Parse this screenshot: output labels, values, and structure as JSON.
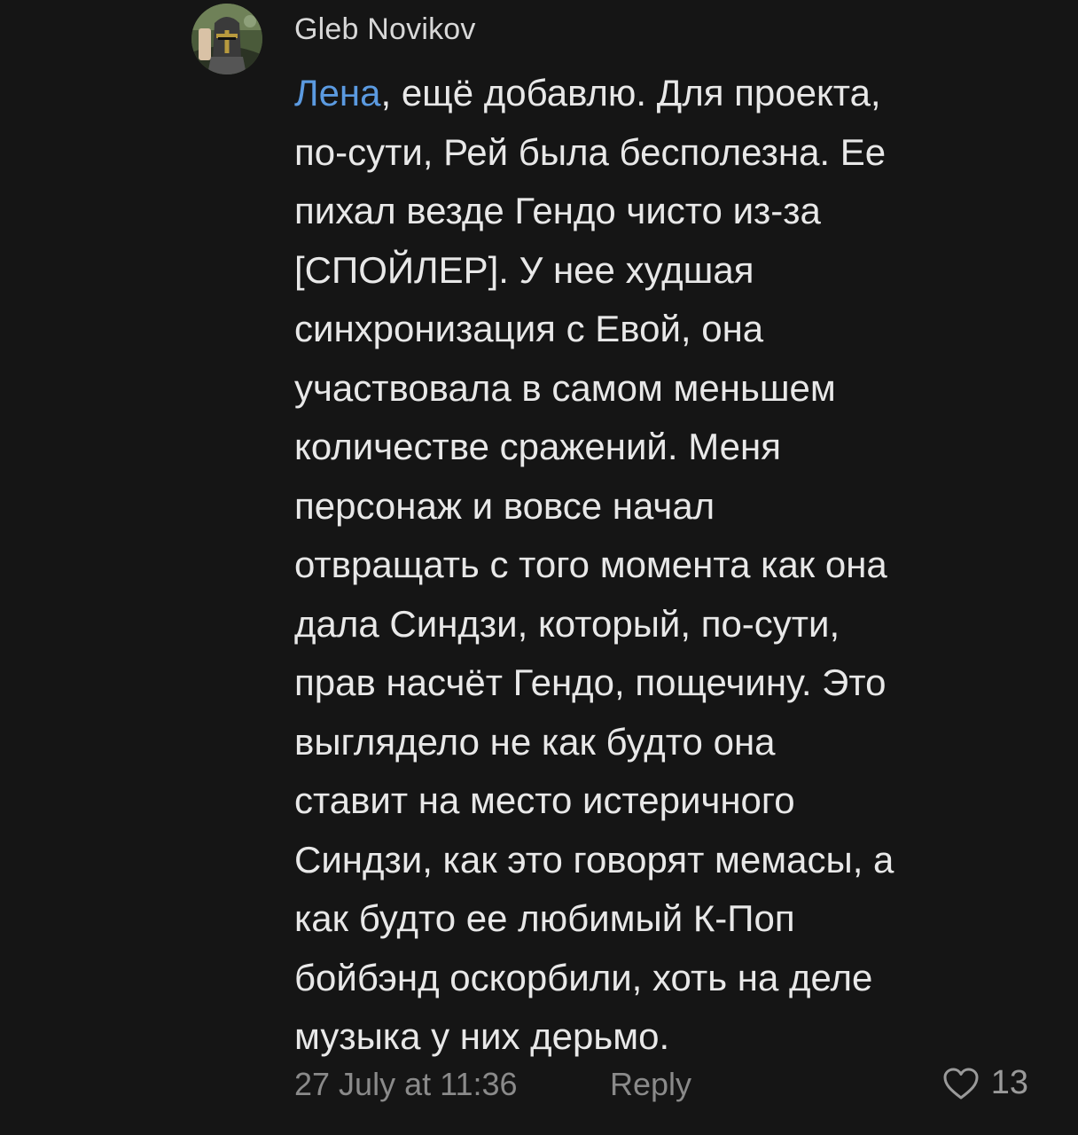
{
  "comment": {
    "author": "Gleb Novikov",
    "mention": "Лена",
    "first_line_rest": ", ещё добавлю. Для проекта,",
    "lines": [
      "по-сути, Рей была бесполезна. Ее",
      "пихал везде Гендо чисто из-за",
      "[СПОЙЛЕР]. У нее худшая",
      "синхронизация с Евой, она",
      "участвовала в самом меньшем",
      "количестве сражений. Меня",
      "персонаж и вовсе начал",
      "отвращать с того момента как она",
      "дала Синдзи, который, по-сути,",
      "прав насчёт Гендо, пощечину. Это",
      "выглядело не как будто она",
      "ставит на место истеричного",
      "Синдзи, как это говорят мемасы, а",
      "как будто ее любимый К-Поп",
      "бойбэнд оскорбили, хоть на деле",
      "музыка у них дерьмо."
    ],
    "timestamp": "27 July at 11:36",
    "reply_label": "Reply",
    "like_count": "13",
    "avatar_icon": "knight-helmet-avatar",
    "like_icon": "heart-outline-icon",
    "mention_color": "#5b9ae0"
  }
}
